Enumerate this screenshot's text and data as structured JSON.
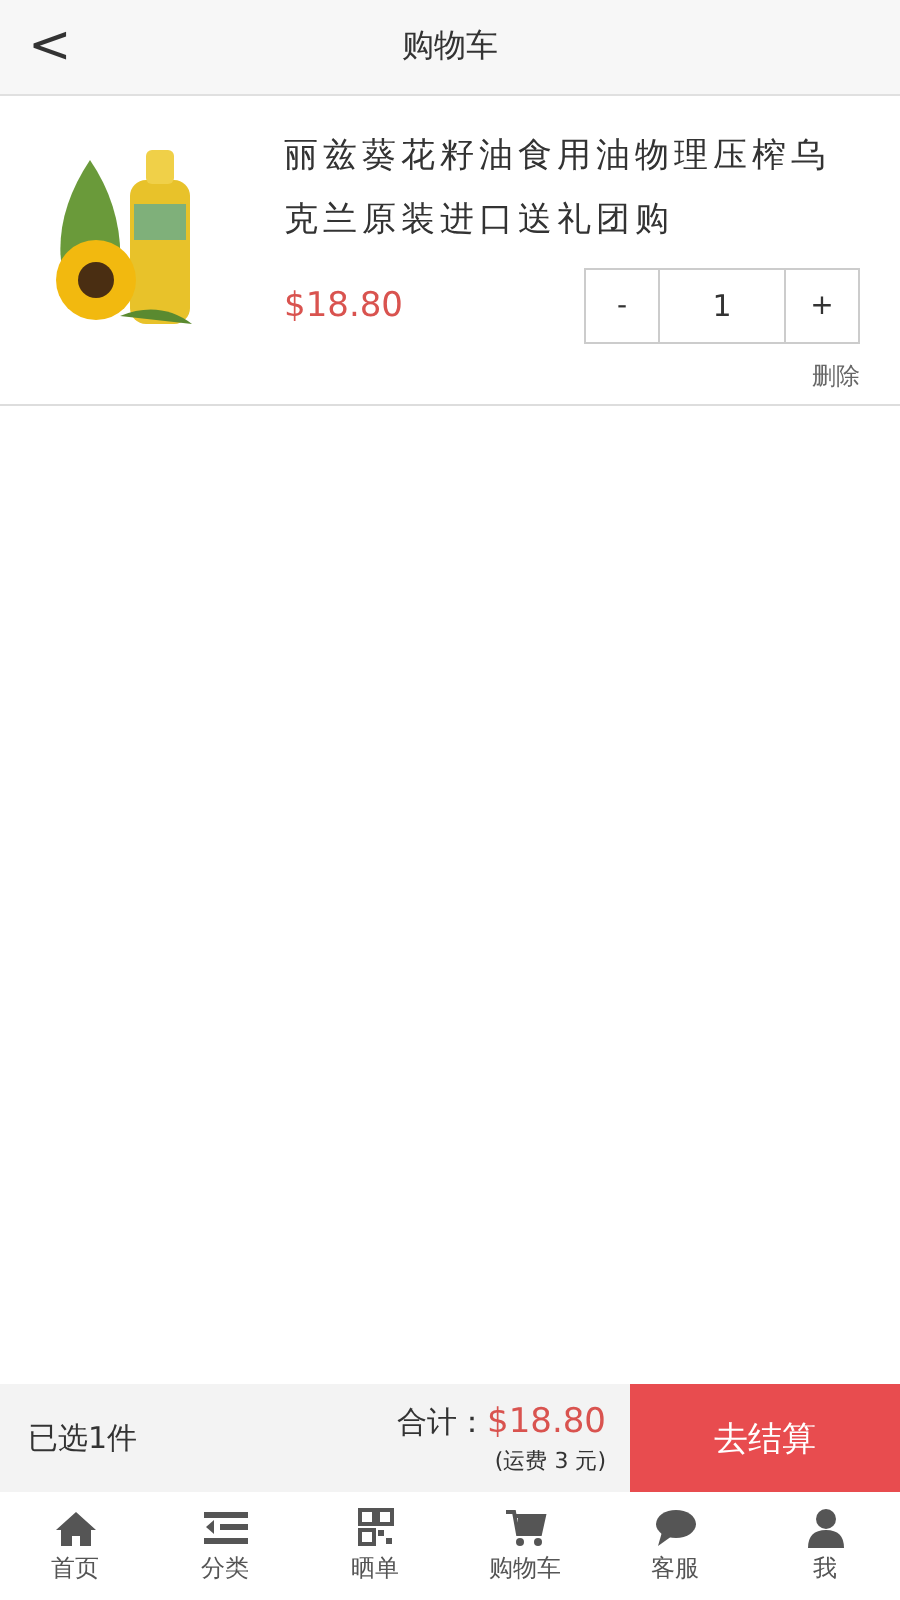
{
  "header": {
    "back": "<",
    "title": "购物车"
  },
  "cart_items": [
    {
      "name": "丽兹葵花籽油食用油物理压榨乌克兰原装进口送礼团购",
      "price": "$18.80",
      "decrease": "-",
      "quantity": "1",
      "increase": "+",
      "delete": "删除"
    }
  ],
  "summary": {
    "selected_count": "已选1件",
    "total_label": "合计：",
    "total": "$18.80",
    "shipping": "(运费 3 元)",
    "checkout": "去结算"
  },
  "tab_bar": [
    {
      "kind": "home",
      "label": "首页"
    },
    {
      "kind": "category",
      "label": "分类"
    },
    {
      "kind": "qr",
      "label": "晒单"
    },
    {
      "kind": "cart",
      "label": "购物车"
    },
    {
      "kind": "chat",
      "label": "客服"
    },
    {
      "kind": "user",
      "label": "我"
    }
  ]
}
